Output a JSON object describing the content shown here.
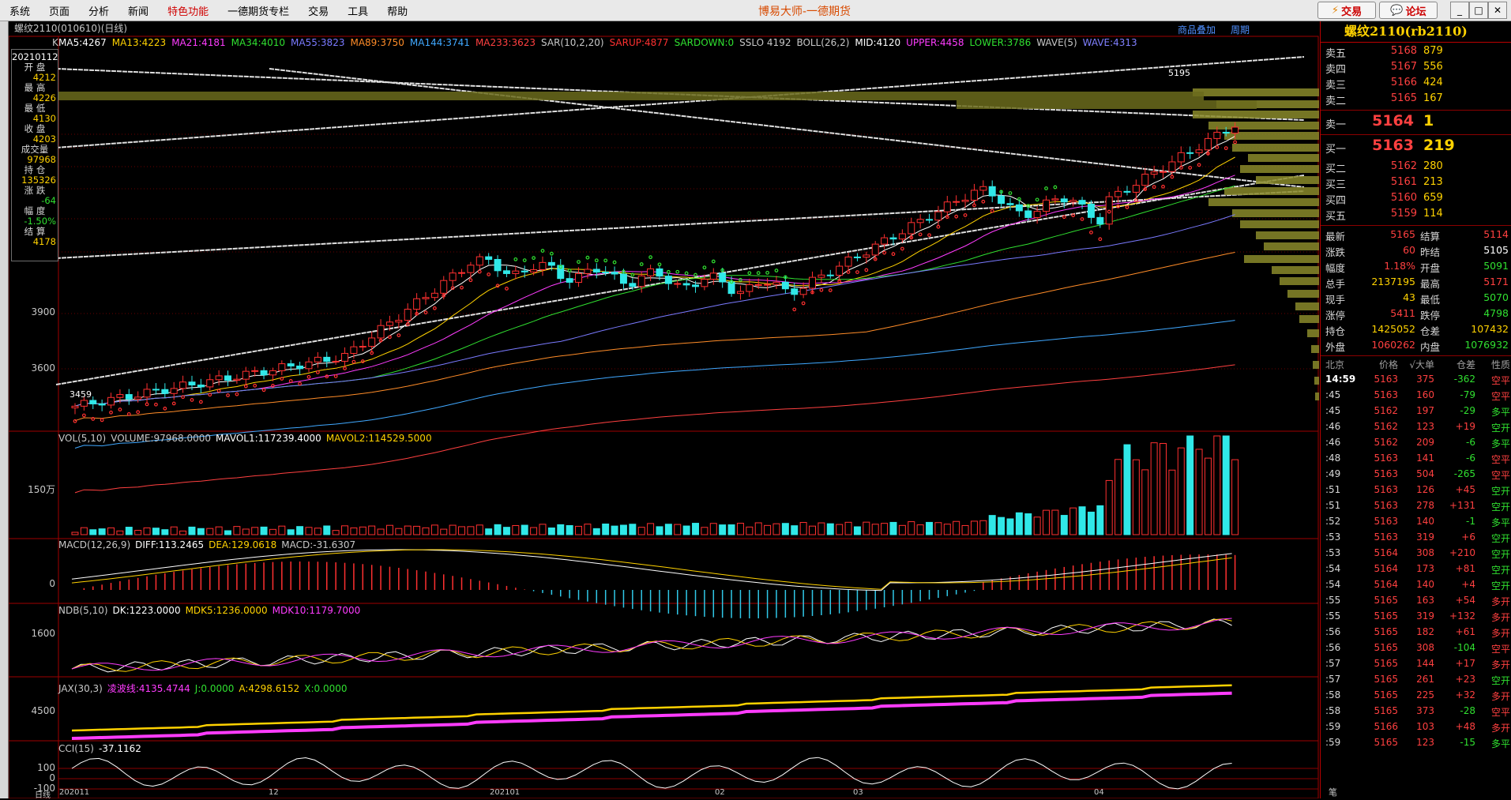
{
  "menu": [
    "系统",
    "页面",
    "分析",
    "新闻",
    "特色功能",
    "一德期货专栏",
    "交易",
    "工具",
    "帮助"
  ],
  "app_title": "博易大师-一德期货",
  "top_buttons": {
    "trade": "交易",
    "forum": "论坛"
  },
  "chart": {
    "period_title": "螺纹2110(010610)(日线)",
    "top_links": [
      "商品叠加",
      "周期"
    ],
    "ma_label": "K",
    "indicators": [
      {
        "t": "MA5:4267",
        "c": "#ffffff"
      },
      {
        "t": "MA13:4223",
        "c": "#ffd200"
      },
      {
        "t": "MA21:4181",
        "c": "#ff3cff"
      },
      {
        "t": "MA34:4010",
        "c": "#30e030"
      },
      {
        "t": "MA55:3823",
        "c": "#7a7aff"
      },
      {
        "t": "MA89:3750",
        "c": "#ff8c28"
      },
      {
        "t": "MA144:3741",
        "c": "#40a8ff"
      },
      {
        "t": "MA233:3623",
        "c": "#ff4040"
      },
      {
        "t": "SAR(10,2,20)",
        "c": "#c8c8c8"
      },
      {
        "t": "SARUP:4877",
        "c": "#ff3030"
      },
      {
        "t": "SARDOWN:0",
        "c": "#30e030"
      },
      {
        "t": "SSLO 4192",
        "c": "#c8c8c8"
      },
      {
        "t": "BOLL(26,2)",
        "c": "#c8c8c8"
      },
      {
        "t": "MID:4120",
        "c": "#ffffff"
      },
      {
        "t": "UPPER:4458",
        "c": "#ff3cff"
      },
      {
        "t": "LOWER:3786",
        "c": "#30e030"
      },
      {
        "t": "WAVE(5)",
        "c": "#c8c8c8"
      },
      {
        "t": "WAVE:4313",
        "c": "#8080ff"
      }
    ],
    "price_axis": [
      "3900",
      "3600"
    ],
    "price_label_high": "5195",
    "price_label_low": "3459",
    "info": {
      "date": "20210112",
      "rows": [
        {
          "l": "开 盘",
          "v": "4212",
          "c": "#ffd200"
        },
        {
          "l": "最 高",
          "v": "4226",
          "c": "#ffd200"
        },
        {
          "l": "最 低",
          "v": "4130",
          "c": "#ffd200"
        },
        {
          "l": "收 盘",
          "v": "4203",
          "c": "#ffd200"
        },
        {
          "l": "成交量",
          "v": "97968",
          "c": "#ffd200"
        },
        {
          "l": "持 仓",
          "v": "135326",
          "c": "#ffd200"
        },
        {
          "l": "涨 跌",
          "v": "-64",
          "c": "#30e030"
        },
        {
          "l": "幅 度",
          "v": "-1.50%",
          "c": "#30e030"
        },
        {
          "l": "结 算",
          "v": "4178",
          "c": "#ffd200"
        }
      ]
    },
    "vol_header": [
      {
        "t": "VOL(5,10)",
        "c": "#c8c8c8"
      },
      {
        "t": "VOLUME:97968.0000",
        "c": "#c8c8c8"
      },
      {
        "t": "MAVOL1:117239.4000",
        "c": "#ffffff"
      },
      {
        "t": "MAVOL2:114529.5000",
        "c": "#ffd200"
      }
    ],
    "vol_axis": "150万",
    "macd_header": [
      {
        "t": "MACD(12,26,9)",
        "c": "#c8c8c8"
      },
      {
        "t": "DIFF:113.2465",
        "c": "#ffffff"
      },
      {
        "t": "DEA:129.0618",
        "c": "#ffd200"
      },
      {
        "t": "MACD:-31.6307",
        "c": "#c8c8c8"
      }
    ],
    "macd_axis": "0",
    "ndb_header": [
      {
        "t": "NDB(5,10)",
        "c": "#c8c8c8"
      },
      {
        "t": "DK:1223.0000",
        "c": "#ffffff"
      },
      {
        "t": "MDK5:1236.0000",
        "c": "#ffd200"
      },
      {
        "t": "MDK10:1179.7000",
        "c": "#ff3cff"
      }
    ],
    "ndb_axis": "1600",
    "jax_header": [
      {
        "t": "JAX(30,3)",
        "c": "#c8c8c8"
      },
      {
        "t": "凌波线:4135.4744",
        "c": "#ff3cff"
      },
      {
        "t": "J:0.0000",
        "c": "#30e030"
      },
      {
        "t": "A:4298.6152",
        "c": "#ffd200"
      },
      {
        "t": "X:0.0000",
        "c": "#30e030"
      }
    ],
    "jax_axis": "4500",
    "cci_header": [
      {
        "t": "CCI(15)",
        "c": "#c8c8c8"
      },
      {
        "t": "-37.1162",
        "c": "#ffffff"
      }
    ],
    "cci_axis": [
      "100",
      "0",
      "-100"
    ],
    "date_axis": [
      "日线",
      "202011",
      "12",
      "202101",
      "02",
      "03",
      "04"
    ]
  },
  "quote": {
    "title": "螺纹2110(rb2110)",
    "asks": [
      {
        "l": "卖五",
        "p": "5168",
        "v": "879"
      },
      {
        "l": "卖四",
        "p": "5167",
        "v": "556"
      },
      {
        "l": "卖三",
        "p": "5166",
        "v": "424"
      },
      {
        "l": "卖二",
        "p": "5165",
        "v": "167"
      }
    ],
    "ask1": {
      "l": "卖一",
      "p": "5164",
      "v": "1"
    },
    "bid1": {
      "l": "买一",
      "p": "5163",
      "v": "219"
    },
    "bids": [
      {
        "l": "买二",
        "p": "5162",
        "v": "280"
      },
      {
        "l": "买三",
        "p": "5161",
        "v": "213"
      },
      {
        "l": "买四",
        "p": "5160",
        "v": "659"
      },
      {
        "l": "买五",
        "p": "5159",
        "v": "114"
      }
    ],
    "stats": [
      {
        "a": "最新",
        "b": "5165",
        "bc": "#ff4040",
        "c": "结算",
        "d": "5114",
        "dc": "#ff4040"
      },
      {
        "a": "涨跌",
        "b": "60",
        "bc": "#ff4040",
        "c": "昨结",
        "d": "5105",
        "dc": "#ffffff"
      },
      {
        "a": "幅度",
        "b": "1.18%",
        "bc": "#ff4040",
        "c": "开盘",
        "d": "5091",
        "dc": "#30e030"
      },
      {
        "a": "总手",
        "b": "2137195",
        "bc": "#ffd200",
        "c": "最高",
        "d": "5171",
        "dc": "#ff4040"
      },
      {
        "a": "现手",
        "b": "43",
        "bc": "#ffd200",
        "c": "最低",
        "d": "5070",
        "dc": "#30e030"
      },
      {
        "a": "涨停",
        "b": "5411",
        "bc": "#ff4040",
        "c": "跌停",
        "d": "4798",
        "dc": "#30e030"
      },
      {
        "a": "持仓",
        "b": "1425052",
        "bc": "#ffd200",
        "c": "仓差",
        "d": "107432",
        "dc": "#ffd200"
      },
      {
        "a": "外盘",
        "b": "1060262",
        "bc": "#ff4040",
        "c": "内盘",
        "d": "1076932",
        "dc": "#30e030"
      }
    ],
    "tick_header": {
      "t": "北京",
      "p": "价格",
      "v": "√大单",
      "c": "仓差",
      "y": "性质"
    },
    "ticks": [
      {
        "t": "14:59",
        "p": "5163",
        "v": "375",
        "c": "-362",
        "cc": "#30e030",
        "y": "空平",
        "yc": "#ff4040"
      },
      {
        "t": ":45",
        "p": "5163",
        "v": "160",
        "c": "-79",
        "cc": "#30e030",
        "y": "空平",
        "yc": "#ff4040"
      },
      {
        "t": ":45",
        "p": "5162",
        "v": "197",
        "c": "-29",
        "cc": "#30e030",
        "y": "多平",
        "yc": "#30e030"
      },
      {
        "t": ":46",
        "p": "5162",
        "v": "123",
        "c": "+19",
        "cc": "#ff4040",
        "y": "空开",
        "yc": "#30e030"
      },
      {
        "t": ":46",
        "p": "5162",
        "v": "209",
        "c": "-6",
        "cc": "#30e030",
        "y": "多平",
        "yc": "#30e030"
      },
      {
        "t": ":48",
        "p": "5163",
        "v": "141",
        "c": "-6",
        "cc": "#30e030",
        "y": "空平",
        "yc": "#ff4040"
      },
      {
        "t": ":49",
        "p": "5163",
        "v": "504",
        "c": "-265",
        "cc": "#30e030",
        "y": "空平",
        "yc": "#ff4040"
      },
      {
        "t": ":51",
        "p": "5163",
        "v": "126",
        "c": "+45",
        "cc": "#ff4040",
        "y": "空开",
        "yc": "#30e030"
      },
      {
        "t": ":51",
        "p": "5163",
        "v": "278",
        "c": "+131",
        "cc": "#ff4040",
        "y": "空开",
        "yc": "#30e030"
      },
      {
        "t": ":52",
        "p": "5163",
        "v": "140",
        "c": "-1",
        "cc": "#30e030",
        "y": "多平",
        "yc": "#30e030"
      },
      {
        "t": ":53",
        "p": "5163",
        "v": "319",
        "c": "+6",
        "cc": "#ff4040",
        "y": "空开",
        "yc": "#30e030"
      },
      {
        "t": ":53",
        "p": "5164",
        "v": "308",
        "c": "+210",
        "cc": "#ff4040",
        "y": "空开",
        "yc": "#30e030"
      },
      {
        "t": ":54",
        "p": "5164",
        "v": "173",
        "c": "+81",
        "cc": "#ff4040",
        "y": "空开",
        "yc": "#30e030"
      },
      {
        "t": ":54",
        "p": "5164",
        "v": "140",
        "c": "+4",
        "cc": "#ff4040",
        "y": "空开",
        "yc": "#30e030"
      },
      {
        "t": ":55",
        "p": "5165",
        "v": "163",
        "c": "+54",
        "cc": "#ff4040",
        "y": "多开",
        "yc": "#ff4040"
      },
      {
        "t": ":55",
        "p": "5165",
        "v": "319",
        "c": "+132",
        "cc": "#ff4040",
        "y": "多开",
        "yc": "#ff4040"
      },
      {
        "t": ":56",
        "p": "5165",
        "v": "182",
        "c": "+61",
        "cc": "#ff4040",
        "y": "多开",
        "yc": "#ff4040"
      },
      {
        "t": ":56",
        "p": "5165",
        "v": "308",
        "c": "-104",
        "cc": "#30e030",
        "y": "空平",
        "yc": "#ff4040"
      },
      {
        "t": ":57",
        "p": "5165",
        "v": "144",
        "c": "+17",
        "cc": "#ff4040",
        "y": "多开",
        "yc": "#ff4040"
      },
      {
        "t": ":57",
        "p": "5165",
        "v": "261",
        "c": "+23",
        "cc": "#ff4040",
        "y": "空开",
        "yc": "#30e030"
      },
      {
        "t": ":58",
        "p": "5165",
        "v": "225",
        "c": "+32",
        "cc": "#ff4040",
        "y": "多开",
        "yc": "#ff4040"
      },
      {
        "t": ":58",
        "p": "5165",
        "v": "373",
        "c": "-28",
        "cc": "#30e030",
        "y": "空平",
        "yc": "#ff4040"
      },
      {
        "t": ":59",
        "p": "5166",
        "v": "103",
        "c": "+48",
        "cc": "#ff4040",
        "y": "多开",
        "yc": "#ff4040"
      },
      {
        "t": ":59",
        "p": "5165",
        "v": "123",
        "c": "-15",
        "cc": "#30e030",
        "y": "多平",
        "yc": "#30e030"
      }
    ],
    "footer": "笔"
  }
}
